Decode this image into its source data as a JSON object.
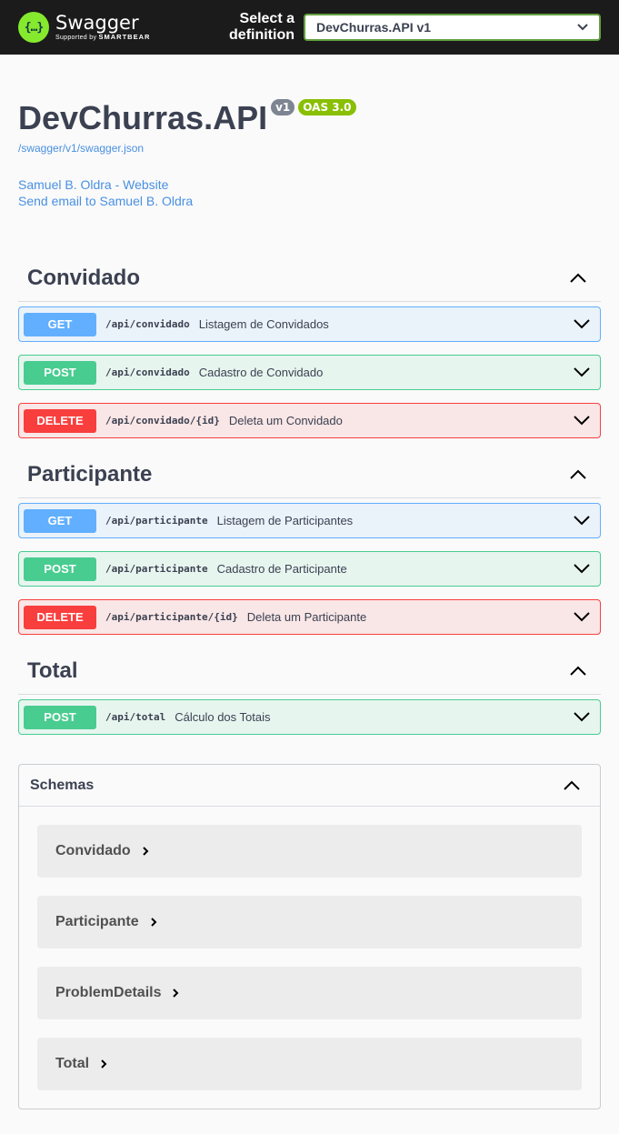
{
  "topbar": {
    "brand_name": "Swagger",
    "brand_sub_prefix": "Supported by",
    "brand_sub_company": "SMARTBEAR",
    "logo_glyph": "{…}",
    "select_label_line1": "Select a",
    "select_label_line2": "definition",
    "selected_definition": "DevChurras.API v1"
  },
  "info": {
    "title": "DevChurras.API",
    "version_badge": "v1",
    "oas_badge": "OAS 3.0",
    "spec_link": "/swagger/v1/swagger.json",
    "contact_website": "Samuel B. Oldra - Website",
    "contact_email": "Send email to Samuel B. Oldra"
  },
  "tags": [
    {
      "name": "Convidado",
      "operations": [
        {
          "method": "GET",
          "path": "/api/convidado",
          "summary": "Listagem de Convidados"
        },
        {
          "method": "POST",
          "path": "/api/convidado",
          "summary": "Cadastro de Convidado"
        },
        {
          "method": "DELETE",
          "path": "/api/convidado/{id}",
          "summary": "Deleta um Convidado"
        }
      ]
    },
    {
      "name": "Participante",
      "operations": [
        {
          "method": "GET",
          "path": "/api/participante",
          "summary": "Listagem de Participantes"
        },
        {
          "method": "POST",
          "path": "/api/participante",
          "summary": "Cadastro de Participante"
        },
        {
          "method": "DELETE",
          "path": "/api/participante/{id}",
          "summary": "Deleta um Participante"
        }
      ]
    },
    {
      "name": "Total",
      "operations": [
        {
          "method": "POST",
          "path": "/api/total",
          "summary": "Cálculo dos Totais"
        }
      ]
    }
  ],
  "schemas": {
    "title": "Schemas",
    "models": [
      "Convidado",
      "Participante",
      "ProblemDetails",
      "Total"
    ]
  },
  "colors": {
    "get": "#61affe",
    "post": "#49cc90",
    "delete": "#f93e3e",
    "link": "#4990e2",
    "logo": "#85ea2d",
    "topbar": "#1b1b1b"
  }
}
